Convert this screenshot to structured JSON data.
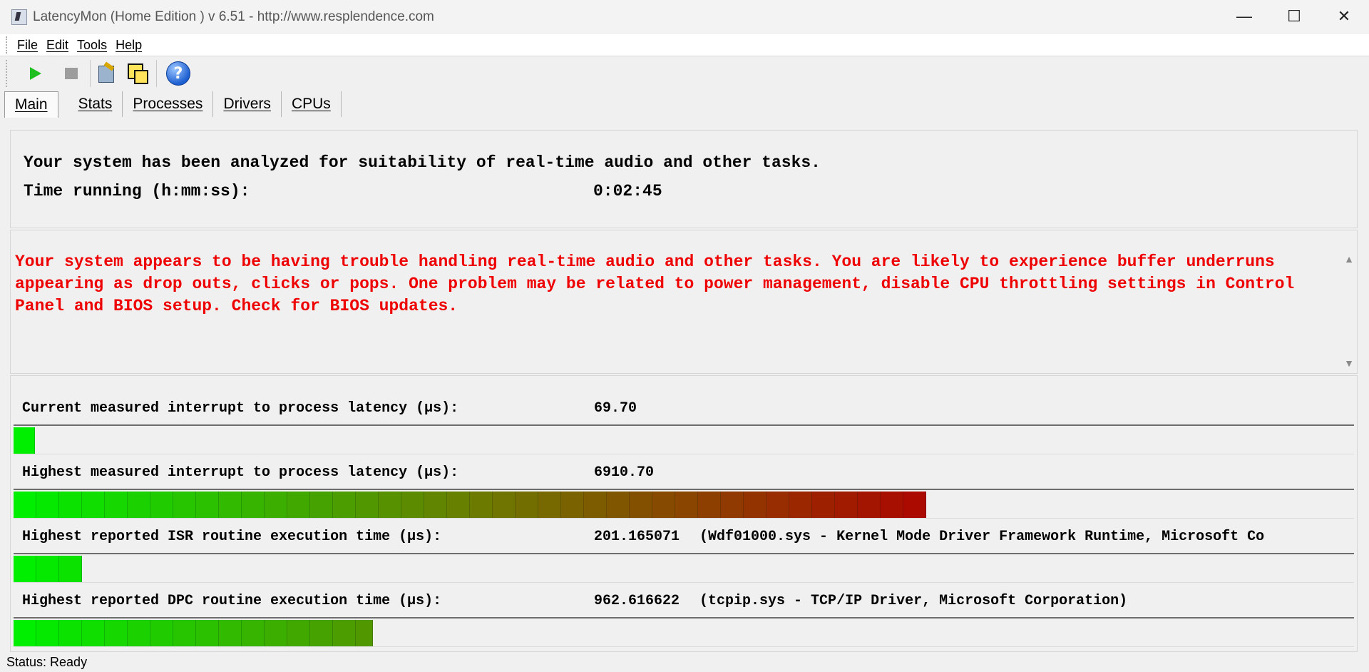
{
  "window": {
    "title": "LatencyMon  (Home Edition )  v 6.51 - http://www.resplendence.com",
    "minimize": "—",
    "maximize": "☐",
    "close": "✕"
  },
  "menu": [
    "File",
    "Edit",
    "Tools",
    "Help"
  ],
  "toolbar": {
    "icons": [
      "play-icon",
      "stop-icon",
      "properties-icon",
      "windows-icon",
      "help-icon"
    ],
    "help_glyph": "?"
  },
  "tabs": [
    "Main",
    "Stats",
    "Processes",
    "Drivers",
    "CPUs"
  ],
  "active_tab": "Main",
  "summary": {
    "analyzed": "Your system has been analyzed for suitability of real-time audio and other tasks.",
    "time_label": "Time running (h:mm:ss):",
    "time_value": "0:02:45"
  },
  "verdict": {
    "message": "Your system appears to be having trouble handling real-time audio and other tasks. You are likely to experience buffer underruns appearing as drop outs, clicks or pops. One problem may be related to power management, disable CPU throttling settings in Control Panel and BIOS setup. Check for BIOS updates.",
    "color": "#e00000"
  },
  "metrics": [
    {
      "label": "Current measured interrupt to process latency (µs):",
      "value": "69.70",
      "extra": "",
      "level": 0.016
    },
    {
      "label": "Highest measured interrupt to process latency (µs):",
      "value": "6910.70",
      "extra": "",
      "level": 0.685
    },
    {
      "label": "Highest reported ISR routine execution time (µs):",
      "value": "201.165071",
      "extra": "(Wdf01000.sys - Kernel Mode Driver Framework Runtime, Microsoft Co",
      "level": 0.052
    },
    {
      "label": "Highest reported DPC routine execution time (µs):",
      "value": "962.616622",
      "extra": "(tcpip.sys - TCP/IP Driver, Microsoft Corporation)",
      "level": 0.268
    }
  ],
  "status": "Status: Ready"
}
